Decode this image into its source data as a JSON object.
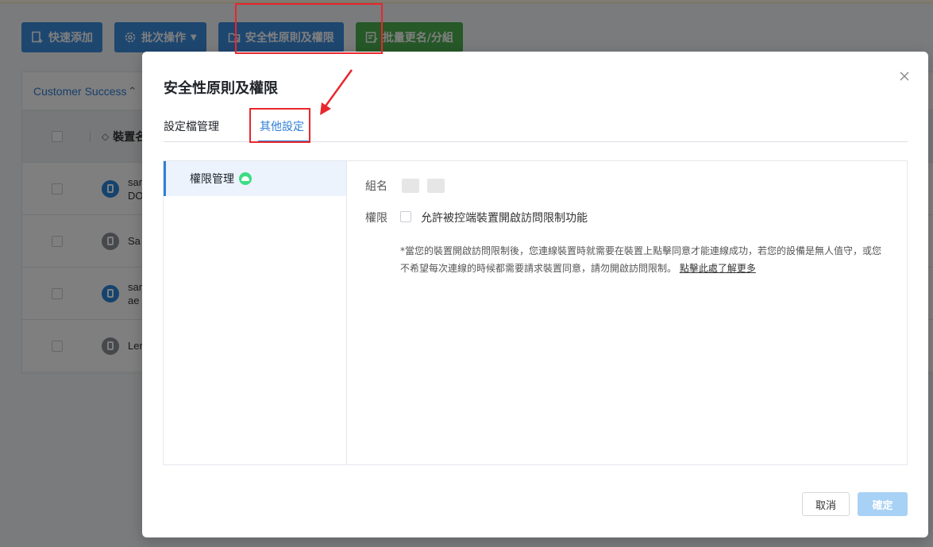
{
  "toolbar": {
    "quick_add": "快速添加",
    "batch_ops": "批次操作",
    "security": "安全性原則及權限",
    "batch_rename": "批量更名/分組"
  },
  "grid": {
    "group_label": "Customer Success",
    "column_device": "裝置名",
    "rows": [
      {
        "text": "san",
        "sub": "DO",
        "icon_color": "blue"
      },
      {
        "text": "Sa",
        "sub": "",
        "icon_color": "gray"
      },
      {
        "text": "san",
        "sub": "ae",
        "icon_color": "blue"
      },
      {
        "text": "Len",
        "sub": "",
        "icon_color": "gray"
      }
    ]
  },
  "dialog": {
    "title": "安全性原則及權限",
    "tabs": [
      "設定檔管理",
      "其他設定"
    ],
    "active_tab": "其他設定",
    "side_item": "權限管理",
    "group_label": "組名",
    "perm_label": "權限",
    "perm_checkbox": "允許被控端裝置開啟訪問限制功能",
    "perm_checked": false,
    "note": "*當您的裝置開啟訪問限制後，您連線裝置時就需要在裝置上點擊同意才能連線成功，若您的設備是無人值守，或您不希望每次連線的時候都需要請求裝置同意，請勿開啟訪問限制。",
    "note_link": "點擊此處了解更多",
    "cancel": "取消",
    "ok": "確定"
  },
  "colors": {
    "primary": "#2f7fd6",
    "green": "#4cb050",
    "annotation": "#e8272d"
  }
}
